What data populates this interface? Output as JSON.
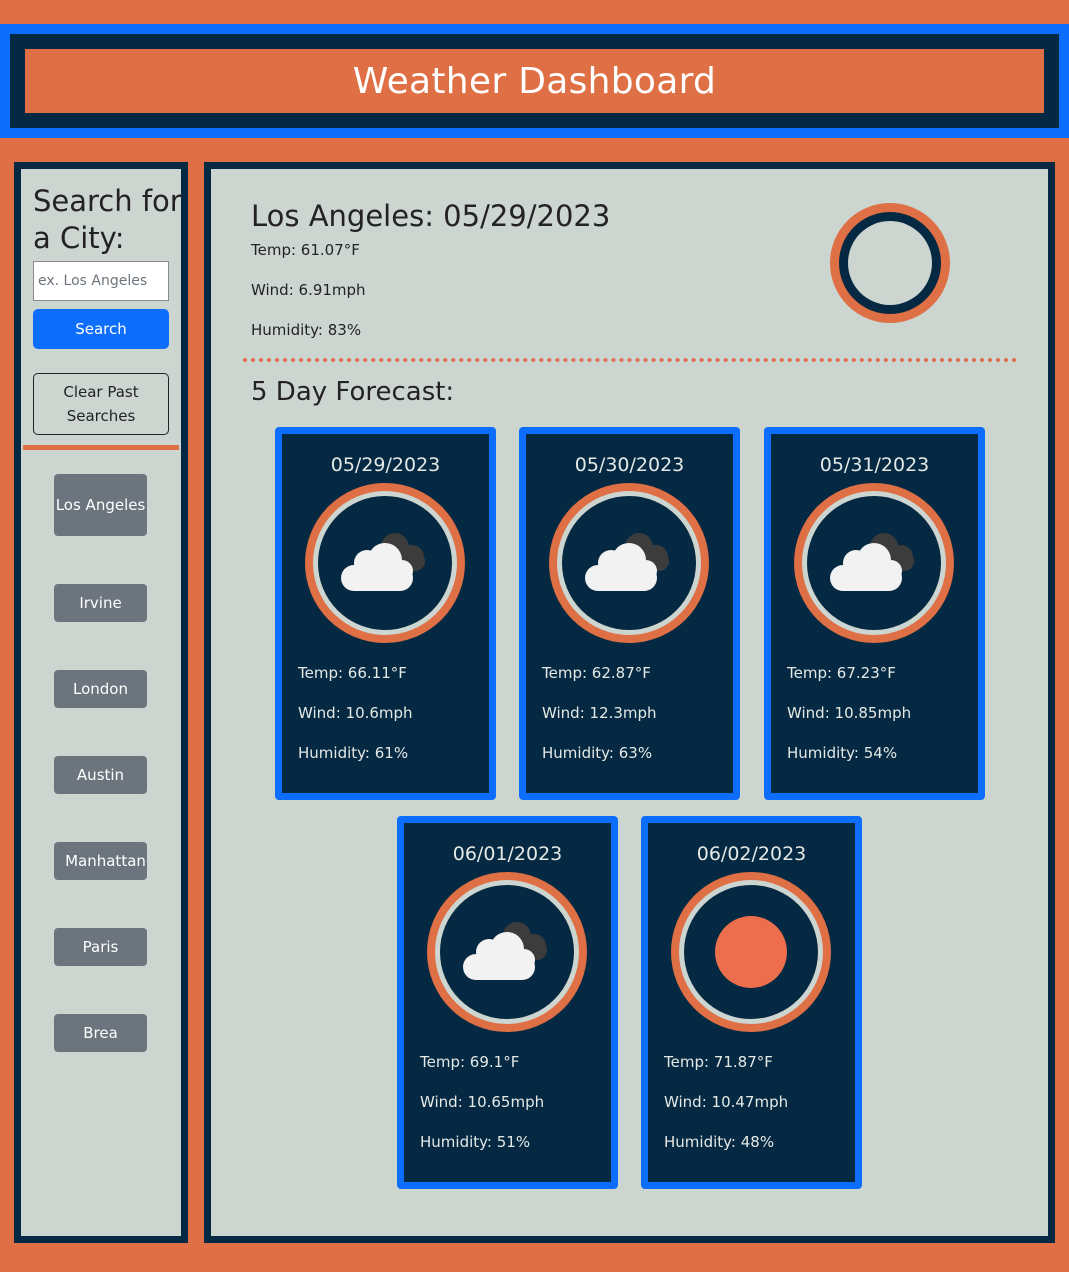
{
  "header": {
    "title": "Weather Dashboard"
  },
  "sidebar": {
    "heading": "Search for a City:",
    "search_placeholder": "ex. Los Angeles",
    "search_value": "",
    "search_label": "Search",
    "clear_label": "Clear Past Searches",
    "history": [
      "Los Angeles",
      "Irvine",
      "London",
      "Austin",
      "Manhattan",
      "Paris",
      "Brea"
    ]
  },
  "current": {
    "title": "Los Angeles: 05/29/2023",
    "temp": "Temp: 61.07°F",
    "wind": "Wind: 6.91mph",
    "humidity": "Humidity: 83%",
    "icon": "broken-clouds-icon"
  },
  "forecast": {
    "heading": "5 Day Forecast:",
    "days": [
      {
        "date": "05/29/2023",
        "icon": "broken-clouds-icon",
        "temp": "Temp: 66.11°F",
        "wind": "Wind: 10.6mph",
        "humidity": "Humidity: 61%"
      },
      {
        "date": "05/30/2023",
        "icon": "broken-clouds-icon",
        "temp": "Temp: 62.87°F",
        "wind": "Wind: 12.3mph",
        "humidity": "Humidity: 63%"
      },
      {
        "date": "05/31/2023",
        "icon": "broken-clouds-icon",
        "temp": "Temp: 67.23°F",
        "wind": "Wind: 10.85mph",
        "humidity": "Humidity: 54%"
      },
      {
        "date": "06/01/2023",
        "icon": "broken-clouds-icon",
        "temp": "Temp: 69.1°F",
        "wind": "Wind: 10.65mph",
        "humidity": "Humidity: 51%"
      },
      {
        "date": "06/02/2023",
        "icon": "clear-sky-sun-icon",
        "temp": "Temp: 71.87°F",
        "wind": "Wind: 10.47mph",
        "humidity": "Humidity: 48%"
      }
    ]
  },
  "colors": {
    "accent_orange": "#df6f44",
    "navy": "#052942",
    "blue": "#0d6efd",
    "panel_gray": "#cdd5d1",
    "city_button_gray": "#6c757d",
    "sun": "#ec6e4c"
  }
}
